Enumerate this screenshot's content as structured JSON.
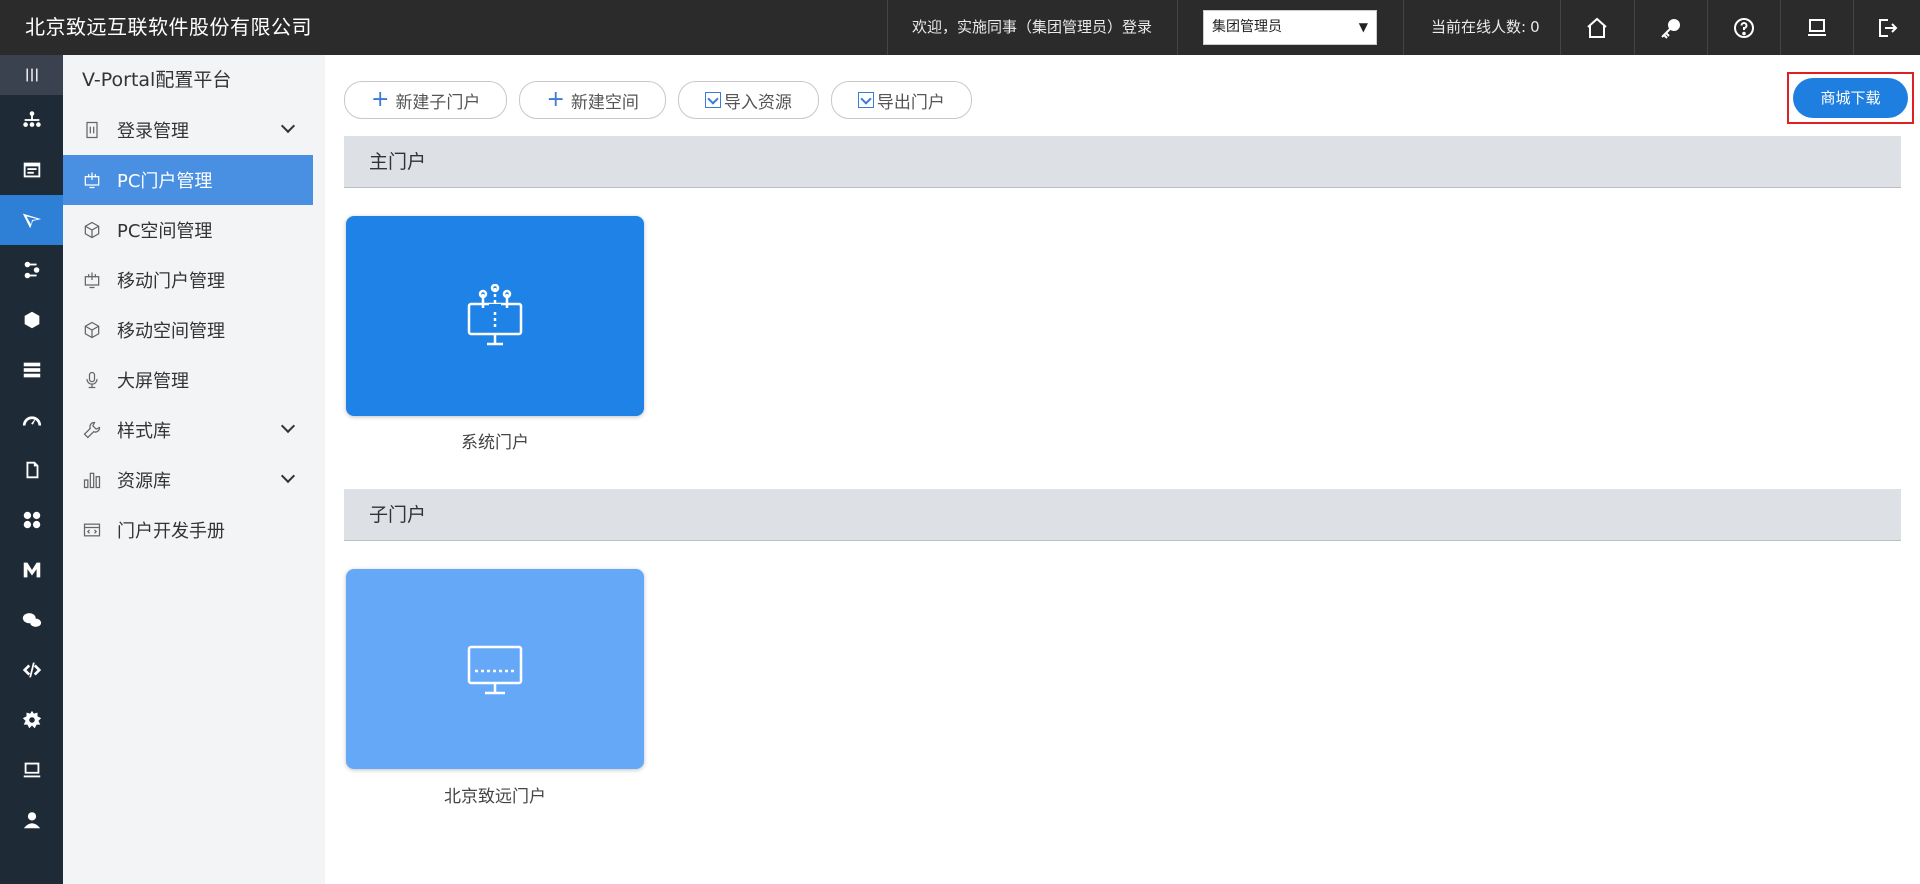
{
  "header": {
    "company": "北京致远互联软件股份有限公司",
    "welcome": "欢迎，实施同事（集团管理员）登录",
    "role_selected": "集团管理员",
    "online_label": "当前在线人数:",
    "online_count": "0",
    "icons": [
      "home-icon",
      "key-icon",
      "help-icon",
      "monitor-icon",
      "logout-icon"
    ]
  },
  "rail": {
    "icons": [
      "menu-icon",
      "org-chart-icon",
      "form-icon",
      "portal-icon",
      "workflow-icon",
      "cap-icon",
      "database-icon",
      "dashboard-icon",
      "document-icon",
      "apps-icon",
      "m-icon",
      "chat-icon",
      "code-icon",
      "settings-icon",
      "screen-icon",
      "user-icon"
    ],
    "active_index": 3
  },
  "menu": {
    "title": "V-Portal配置平台",
    "items": [
      {
        "label": "登录管理",
        "icon": "login-icon",
        "expandable": true
      },
      {
        "label": "PC门户管理",
        "icon": "pc-portal-icon",
        "expandable": false,
        "active": true
      },
      {
        "label": "PC空间管理",
        "icon": "cube-icon",
        "expandable": false
      },
      {
        "label": "移动门户管理",
        "icon": "mobile-portal-icon",
        "expandable": false
      },
      {
        "label": "移动空间管理",
        "icon": "cube-icon",
        "expandable": false
      },
      {
        "label": "大屏管理",
        "icon": "big-screen-icon",
        "expandable": false
      },
      {
        "label": "样式库",
        "icon": "wrench-icon",
        "expandable": true
      },
      {
        "label": "资源库",
        "icon": "bars-icon",
        "expandable": true
      },
      {
        "label": "门户开发手册",
        "icon": "code-window-icon",
        "expandable": false
      }
    ]
  },
  "toolbar": {
    "new_sub_portal": "新建子门户",
    "new_space": "新建空间",
    "import_resource": "导入资源",
    "export_portal": "导出门户",
    "mall_download": "商城下载"
  },
  "sections": {
    "main_portal": {
      "title": "主门户",
      "card": {
        "label": "系统门户",
        "color": "#1e82e6",
        "icon": "portal-tree-icon"
      }
    },
    "sub_portal": {
      "title": "子门户",
      "card": {
        "label": "北京致远门户",
        "color": "#66a8f8",
        "icon": "monitor-icon"
      }
    }
  }
}
